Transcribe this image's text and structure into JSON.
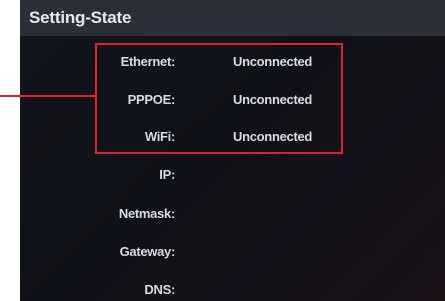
{
  "screen": {
    "title": "Setting-State"
  },
  "status": [
    {
      "label": "Ethernet:",
      "value": "Unconnected"
    },
    {
      "label": "PPPOE:",
      "value": "Unconnected"
    },
    {
      "label": "WiFi:",
      "value": "Unconnected"
    }
  ],
  "network": [
    {
      "label": "IP:",
      "value": ""
    },
    {
      "label": "Netmask:",
      "value": ""
    },
    {
      "label": "Gateway:",
      "value": ""
    },
    {
      "label": "DNS:",
      "value": ""
    }
  ],
  "colors": {
    "highlight": "#e0202a",
    "title_bar": "#2b2f3a",
    "background": "#12141b",
    "text": "#d8dbe2"
  }
}
